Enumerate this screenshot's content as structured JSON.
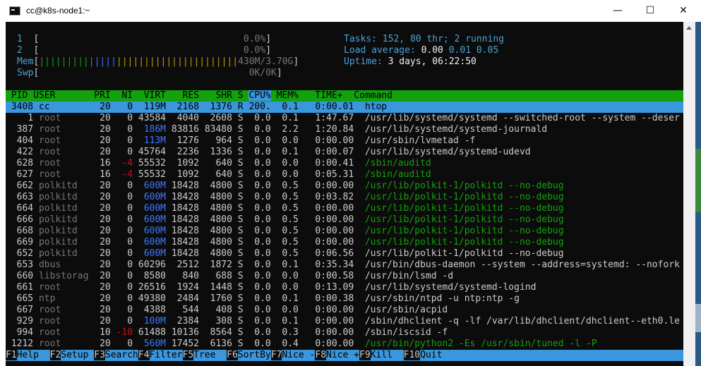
{
  "window": {
    "title": "cc@k8s-node1:~",
    "minimize_icon": "—",
    "maximize_icon": "☐",
    "close_icon": "✕"
  },
  "meters": {
    "cpu1_label": "1",
    "cpu1_value": "0.0%",
    "cpu2_label": "2",
    "cpu2_value": "0.0%",
    "mem_label": "Mem",
    "mem_value": "430M/3.70G",
    "swp_label": "Swp",
    "swp_value": "0K/0K",
    "tasks_label": "Tasks:",
    "tasks_value": "152,",
    "threads_value": "80",
    "threads_label": "thr;",
    "running_value": "2",
    "running_label": "running",
    "load_label": "Load average:",
    "load_1": "0.00",
    "load_5": "0.01",
    "load_15": "0.05",
    "uptime_label": "Uptime:",
    "uptime_value": "3 days, 06:22:50"
  },
  "header": {
    "pid": "PID",
    "user": "USER",
    "pri": "PRI",
    "ni": "NI",
    "virt": "VIRT",
    "res": "RES",
    "shr": "SHR",
    "s": "S",
    "cpu": "CPU%",
    "mem": "MEM%",
    "time": "TIME+",
    "command": "Command"
  },
  "processes": [
    {
      "pid": "3408",
      "user": "cc",
      "pri": "20",
      "ni": "0",
      "virt": "119M",
      "res": "2168",
      "shr": "1376",
      "s": "R",
      "cpu": "200.",
      "mem": "0.1",
      "time": "0:00.01",
      "cmd": "htop"
    },
    {
      "pid": "1",
      "user": "root",
      "pri": "20",
      "ni": "0",
      "virt": "43584",
      "res": "4040",
      "shr": "2608",
      "s": "S",
      "cpu": "0.0",
      "mem": "0.1",
      "time": "1:47.67",
      "cmd": "/usr/lib/systemd/systemd --switched-root --system --deser"
    },
    {
      "pid": "387",
      "user": "root",
      "pri": "20",
      "ni": "0",
      "virt": "186M",
      "res": "83816",
      "shr": "83480",
      "s": "S",
      "cpu": "0.0",
      "mem": "2.2",
      "time": "1:20.84",
      "cmd": "/usr/lib/systemd/systemd-journald"
    },
    {
      "pid": "404",
      "user": "root",
      "pri": "20",
      "ni": "0",
      "virt": "113M",
      "res": "1276",
      "shr": "964",
      "s": "S",
      "cpu": "0.0",
      "mem": "0.0",
      "time": "0:00.00",
      "cmd": "/usr/sbin/lvmetad -f"
    },
    {
      "pid": "422",
      "user": "root",
      "pri": "20",
      "ni": "0",
      "virt": "45764",
      "res": "2236",
      "shr": "1336",
      "s": "S",
      "cpu": "0.0",
      "mem": "0.1",
      "time": "0:00.07",
      "cmd": "/usr/lib/systemd/systemd-udevd"
    },
    {
      "pid": "628",
      "user": "root",
      "pri": "16",
      "ni": "-4",
      "virt": "55532",
      "res": "1092",
      "shr": "640",
      "s": "S",
      "cpu": "0.0",
      "mem": "0.0",
      "time": "0:00.41",
      "cmd": "/sbin/auditd"
    },
    {
      "pid": "627",
      "user": "root",
      "pri": "16",
      "ni": "-4",
      "virt": "55532",
      "res": "1092",
      "shr": "640",
      "s": "S",
      "cpu": "0.0",
      "mem": "0.0",
      "time": "0:05.31",
      "cmd": "/sbin/auditd"
    },
    {
      "pid": "662",
      "user": "polkitd",
      "pri": "20",
      "ni": "0",
      "virt": "600M",
      "res": "18428",
      "shr": "4800",
      "s": "S",
      "cpu": "0.0",
      "mem": "0.5",
      "time": "0:00.00",
      "cmd": "/usr/lib/polkit-1/polkitd --no-debug"
    },
    {
      "pid": "663",
      "user": "polkitd",
      "pri": "20",
      "ni": "0",
      "virt": "600M",
      "res": "18428",
      "shr": "4800",
      "s": "S",
      "cpu": "0.0",
      "mem": "0.5",
      "time": "0:03.82",
      "cmd": "/usr/lib/polkit-1/polkitd --no-debug"
    },
    {
      "pid": "664",
      "user": "polkitd",
      "pri": "20",
      "ni": "0",
      "virt": "600M",
      "res": "18428",
      "shr": "4800",
      "s": "S",
      "cpu": "0.0",
      "mem": "0.5",
      "time": "0:00.00",
      "cmd": "/usr/lib/polkit-1/polkitd --no-debug"
    },
    {
      "pid": "666",
      "user": "polkitd",
      "pri": "20",
      "ni": "0",
      "virt": "600M",
      "res": "18428",
      "shr": "4800",
      "s": "S",
      "cpu": "0.0",
      "mem": "0.5",
      "time": "0:00.00",
      "cmd": "/usr/lib/polkit-1/polkitd --no-debug"
    },
    {
      "pid": "668",
      "user": "polkitd",
      "pri": "20",
      "ni": "0",
      "virt": "600M",
      "res": "18428",
      "shr": "4800",
      "s": "S",
      "cpu": "0.0",
      "mem": "0.5",
      "time": "0:00.00",
      "cmd": "/usr/lib/polkit-1/polkitd --no-debug"
    },
    {
      "pid": "669",
      "user": "polkitd",
      "pri": "20",
      "ni": "0",
      "virt": "600M",
      "res": "18428",
      "shr": "4800",
      "s": "S",
      "cpu": "0.0",
      "mem": "0.5",
      "time": "0:00.00",
      "cmd": "/usr/lib/polkit-1/polkitd --no-debug"
    },
    {
      "pid": "652",
      "user": "polkitd",
      "pri": "20",
      "ni": "0",
      "virt": "600M",
      "res": "18428",
      "shr": "4800",
      "s": "S",
      "cpu": "0.0",
      "mem": "0.5",
      "time": "0:06.56",
      "cmd": "/usr/lib/polkit-1/polkitd --no-debug"
    },
    {
      "pid": "653",
      "user": "dbus",
      "pri": "20",
      "ni": "0",
      "virt": "60296",
      "res": "2512",
      "shr": "1872",
      "s": "S",
      "cpu": "0.0",
      "mem": "0.1",
      "time": "0:35.34",
      "cmd": "/usr/bin/dbus-daemon --system --address=systemd: --nofork"
    },
    {
      "pid": "660",
      "user": "libstorag",
      "pri": "20",
      "ni": "0",
      "virt": "8580",
      "res": "840",
      "shr": "688",
      "s": "S",
      "cpu": "0.0",
      "mem": "0.0",
      "time": "0:00.58",
      "cmd": "/usr/bin/lsmd -d"
    },
    {
      "pid": "661",
      "user": "root",
      "pri": "20",
      "ni": "0",
      "virt": "26516",
      "res": "1924",
      "shr": "1448",
      "s": "S",
      "cpu": "0.0",
      "mem": "0.0",
      "time": "0:13.09",
      "cmd": "/usr/lib/systemd/systemd-logind"
    },
    {
      "pid": "665",
      "user": "ntp",
      "pri": "20",
      "ni": "0",
      "virt": "49380",
      "res": "2484",
      "shr": "1760",
      "s": "S",
      "cpu": "0.0",
      "mem": "0.1",
      "time": "0:00.38",
      "cmd": "/usr/sbin/ntpd -u ntp:ntp -g"
    },
    {
      "pid": "667",
      "user": "root",
      "pri": "20",
      "ni": "0",
      "virt": "4388",
      "res": "544",
      "shr": "408",
      "s": "S",
      "cpu": "0.0",
      "mem": "0.0",
      "time": "0:00.00",
      "cmd": "/usr/sbin/acpid"
    },
    {
      "pid": "929",
      "user": "root",
      "pri": "20",
      "ni": "0",
      "virt": "100M",
      "res": "2384",
      "shr": "308",
      "s": "S",
      "cpu": "0.0",
      "mem": "0.1",
      "time": "0:00.00",
      "cmd": "/sbin/dhclient -q -lf /var/lib/dhclient/dhclient--eth0.le"
    },
    {
      "pid": "994",
      "user": "root",
      "pri": "10",
      "ni": "-10",
      "virt": "61488",
      "res": "10136",
      "shr": "8564",
      "s": "S",
      "cpu": "0.0",
      "mem": "0.3",
      "time": "0:00.00",
      "cmd": "/sbin/iscsid -f"
    },
    {
      "pid": "1212",
      "user": "root",
      "pri": "20",
      "ni": "0",
      "virt": "560M",
      "res": "17452",
      "shr": "6136",
      "s": "S",
      "cpu": "0.0",
      "mem": "0.4",
      "time": "0:00.00",
      "cmd": "/usr/bin/python2 -Es /usr/sbin/tuned -l -P"
    }
  ],
  "function_keys": [
    {
      "key": "F1",
      "label": "Help  "
    },
    {
      "key": "F2",
      "label": "Setup "
    },
    {
      "key": "F3",
      "label": "Search"
    },
    {
      "key": "F4",
      "label": "Filter"
    },
    {
      "key": "F5",
      "label": "Tree  "
    },
    {
      "key": "F6",
      "label": "SortBy"
    },
    {
      "key": "F7",
      "label": "Nice -"
    },
    {
      "key": "F8",
      "label": "Nice +"
    },
    {
      "key": "F9",
      "label": "Kill  "
    },
    {
      "key": "F10",
      "label": "Quit"
    }
  ],
  "colors": {
    "terminal_bg": "#0c0c0c",
    "header_bg": "#13a10e",
    "selection_bg": "#3a96dd",
    "cyan": "#3a96dd",
    "blue": "#3b78ff",
    "green": "#13a10e",
    "yellow": "#c19c00",
    "red": "#c50f1f"
  }
}
